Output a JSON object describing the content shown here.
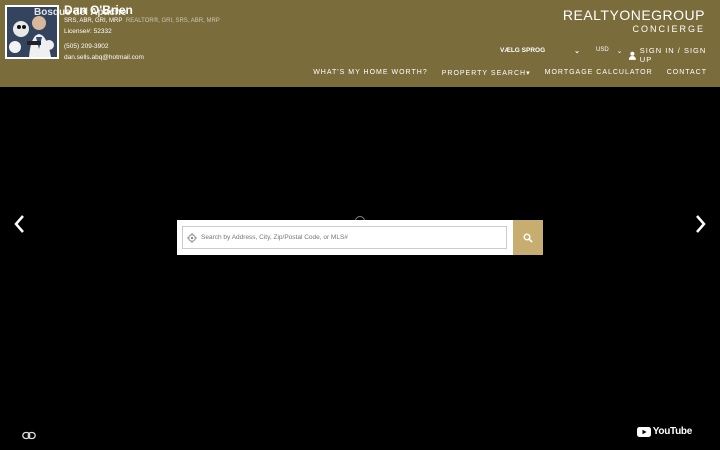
{
  "agent": {
    "name": "Dan O'Brien",
    "overlay_text": "Bosque del Apache",
    "designations": "SRS, ABR, GRI, MRP",
    "designations_overlay": "REALTOR®, GRI, SRS, ABR, MRP",
    "license": "License#: 52332",
    "phone": "(505) 209-3902",
    "email": "dan.sells.abq@hotmail.com"
  },
  "brand": {
    "line1": "REALTYONEGROUP",
    "line2": "CONCIERGE"
  },
  "topbar": {
    "language": "VÆLG SPROG",
    "currency": "USD",
    "signin": "SIGN IN / SIGN UP"
  },
  "nav": {
    "items": [
      "WHAT'S MY HOME WORTH?",
      "PROPERTY SEARCH",
      "MORTGAGE CALCULATOR",
      "CONTACT"
    ]
  },
  "search": {
    "placeholder": "Search by Address, City, Zip/Postal Code, or MLS#"
  },
  "footer": {
    "youtube": "YouTube"
  },
  "colors": {
    "header_bg": "#7b6c3c",
    "search_button": "#c7ad6f"
  }
}
